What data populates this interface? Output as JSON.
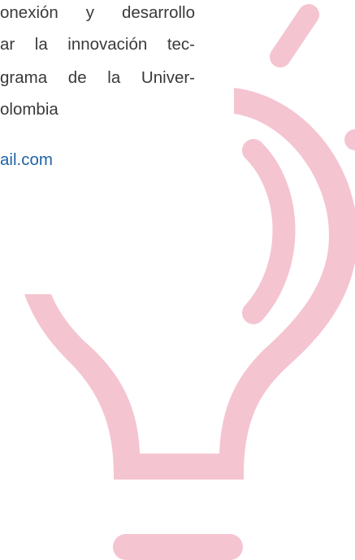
{
  "body_text": {
    "line1": "onexión y desarrollo",
    "line2": "ar la innovación tec-",
    "line3": "grama de la Univer-",
    "line4": "olombia"
  },
  "contact": {
    "email_fragment": "ail.com"
  },
  "decoration": {
    "icon": "lightbulb-icon",
    "color": "#f5c4d1"
  }
}
